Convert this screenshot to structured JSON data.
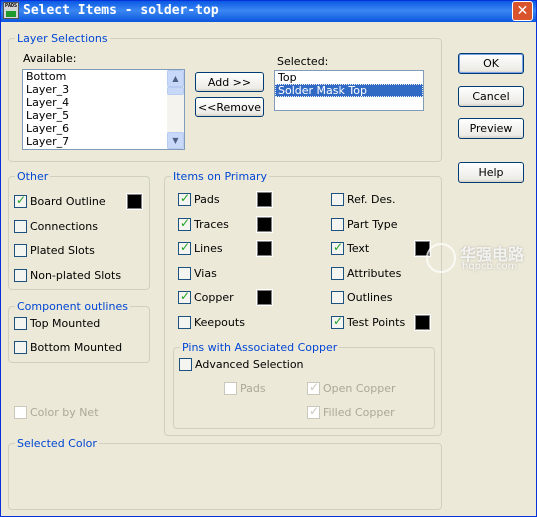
{
  "window": {
    "title": "Select Items - solder-top",
    "close_glyph": "✕",
    "app_icon_text": "PADS",
    "title_bar_color": "#0A58E4"
  },
  "layer_selections": {
    "group_title": "Layer Selections",
    "available_label": "Available:",
    "available_items": [
      "Bottom",
      "Layer_3",
      "Layer_4",
      "Layer_5",
      "Layer_6",
      "Layer_7"
    ],
    "selected_label": "Selected:",
    "selected_items": [
      "Top",
      "Solder Mask Top"
    ],
    "selected_highlight_index": 1,
    "add_button": "Add >>",
    "remove_button": "<<Remove"
  },
  "buttons": {
    "ok": "OK",
    "cancel": "Cancel",
    "preview": "Preview",
    "help": "Help"
  },
  "other": {
    "group_title": "Other",
    "items": [
      {
        "label": "Board Outline",
        "checked": true,
        "swatch": true
      },
      {
        "label": "Connections",
        "checked": false
      },
      {
        "label": "Plated Slots",
        "checked": false
      },
      {
        "label": "Non-plated Slots",
        "checked": false
      }
    ]
  },
  "component_outlines": {
    "group_title": "Component outlines",
    "items": [
      {
        "label": "Top Mounted",
        "checked": false
      },
      {
        "label": "Bottom Mounted",
        "checked": false
      }
    ]
  },
  "color_by_net": {
    "label": "Color by Net",
    "checked": false,
    "enabled": false
  },
  "items_on_primary": {
    "group_title": "Items on Primary",
    "left": [
      {
        "label": "Pads",
        "checked": true,
        "swatch": true
      },
      {
        "label": "Traces",
        "checked": true,
        "swatch": true
      },
      {
        "label": "Lines",
        "checked": true,
        "swatch": true
      },
      {
        "label": "Vias",
        "checked": false
      },
      {
        "label": "Copper",
        "checked": true,
        "swatch": true
      },
      {
        "label": "Keepouts",
        "checked": false
      }
    ],
    "right": [
      {
        "label": "Ref. Des.",
        "checked": false
      },
      {
        "label": "Part Type",
        "checked": false
      },
      {
        "label": "Text",
        "checked": true,
        "swatch": true
      },
      {
        "label": "Attributes",
        "checked": false
      },
      {
        "label": "Outlines",
        "checked": false
      },
      {
        "label": "Test Points",
        "checked": true,
        "swatch": true
      }
    ]
  },
  "pins_with_copper": {
    "group_title": "Pins with Associated Copper",
    "advanced_selection": {
      "label": "Advanced Selection",
      "checked": false
    },
    "pads": {
      "label": "Pads",
      "checked": false
    },
    "open_copper": {
      "label": "Open Copper",
      "checked": true
    },
    "filled_copper": {
      "label": "Filled Copper",
      "checked": true
    }
  },
  "selected_color": {
    "group_title": "Selected Color"
  },
  "watermark": {
    "text": "华强电路",
    "url": "hqpcb.com"
  },
  "colors": {
    "accent": "#0046D5",
    "selection": "#316AC5",
    "dialog_bg": "#ECE9D8",
    "swatch": "#000000"
  }
}
